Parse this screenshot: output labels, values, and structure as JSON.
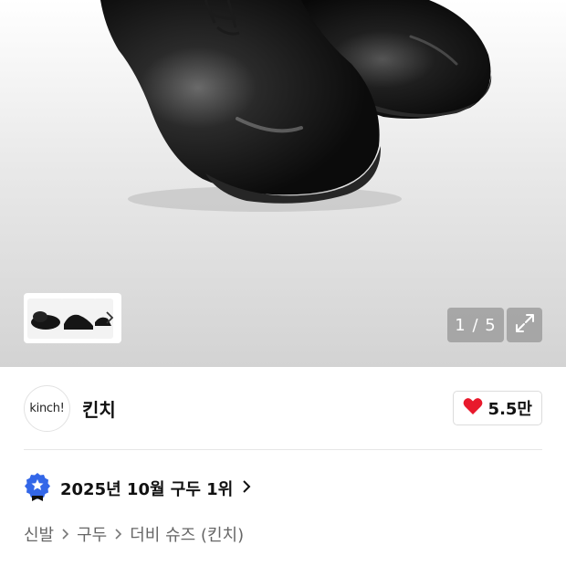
{
  "gallery": {
    "counter": "1 / 5",
    "icons": {
      "expand": "expand-arrows-icon",
      "thumb_next": "chevron-right-icon"
    }
  },
  "brand": {
    "logo_text": "kinch!",
    "name": "킨치",
    "likes": "5.5만",
    "like_icon": "heart-icon",
    "like_color": "#e8192c"
  },
  "ranking": {
    "text": "2025년 10월 구두 1위",
    "badge_icon": "ranking-badge-icon",
    "badge_color": "#3367e8"
  },
  "breadcrumb": {
    "items": [
      "신발",
      "구두",
      "더비 슈즈 (킨치)"
    ]
  }
}
